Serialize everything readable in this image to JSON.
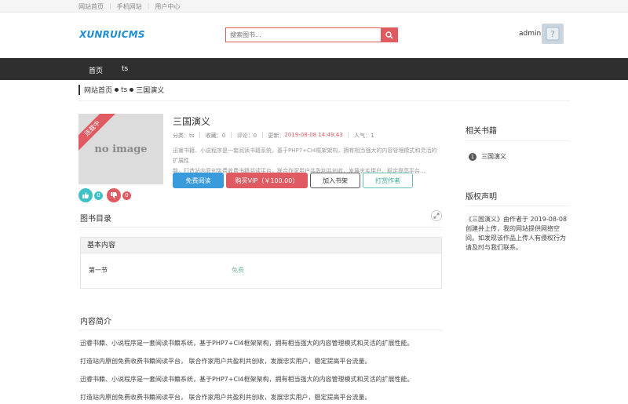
{
  "topbar": {
    "links": [
      "网站首页",
      "手机网站",
      "用户中心"
    ]
  },
  "header": {
    "logo": "XUNRUICMS",
    "search_placeholder": "搜索图书...",
    "user": "admin"
  },
  "nav": {
    "items": [
      "首页",
      "ts"
    ]
  },
  "breadcrumb": {
    "home": "网站首页",
    "category": "ts",
    "current": "三国演义"
  },
  "cover": {
    "ribbon": "连载中",
    "placeholder": "no image"
  },
  "votes": {
    "up": "0",
    "down": "0"
  },
  "book": {
    "title": "三国演义",
    "category_label": "分类：ts",
    "favorites_label": "收藏：0",
    "comments_label": "评论：0",
    "updated_label": "更新：",
    "updated_value": "2019-08-08 14:49:43",
    "popularity_label": "人气：1",
    "summary_line1": "迅睿书籍、小说程序是一套阅读书籍系统，基于PHP7+CI4框架架构，拥有相当强大的内容管理模式和灵活的扩展性",
    "summary_line2": "能。打造站内原创免费收费书籍阅读平台，联合作家用户共盈利共创收，发展忠实用户，稳定提高平台..."
  },
  "actions": {
    "free_read": "免费阅读",
    "buy_vip": "购买VIP（￥100.00）",
    "add_shelf": "加入书架",
    "tip_author": "打赏作者"
  },
  "toc": {
    "title": "图书目录",
    "volume": "基本内容",
    "chapters": [
      {
        "name": "第一节",
        "status": "免费"
      }
    ]
  },
  "intro": {
    "title": "内容简介",
    "paragraphs": [
      "迅睿书籍、小说程序是一套阅读书籍系统，基于PHP7+CI4框架架构，拥有相当强大的内容管理模式和灵活的扩展性能。",
      "打造站内原创免费收费书籍阅读平台， 联合作家用户共盈利共创收，发展忠实用户，稳定提高平台流量。",
      "迅睿书籍、小说程序是一套阅读书籍系统，基于PHP7+CI4框架架构，拥有相当强大的内容管理模式和灵活的扩展性能。",
      "打造站内原创免费收费书籍阅读平台， 联合作家用户共盈利共创收，发展忠实用户，稳定提高平台流量。"
    ]
  },
  "sidebar": {
    "related_title": "相关书籍",
    "related": [
      {
        "rank": "1",
        "title": "三国演义"
      }
    ],
    "copyright_title": "版权声明",
    "copyright_text": "《三国演义》由作者于 2019-08-08 创建并上传，我的网站提供网络空间。如发现该作品上传人有侵权行为请及时与我们联系。"
  },
  "colors": {
    "accent_red": "#e05a61",
    "accent_blue": "#3a9bdc",
    "accent_teal": "#3ec2c8",
    "nav_bg": "#2f2f2f"
  }
}
